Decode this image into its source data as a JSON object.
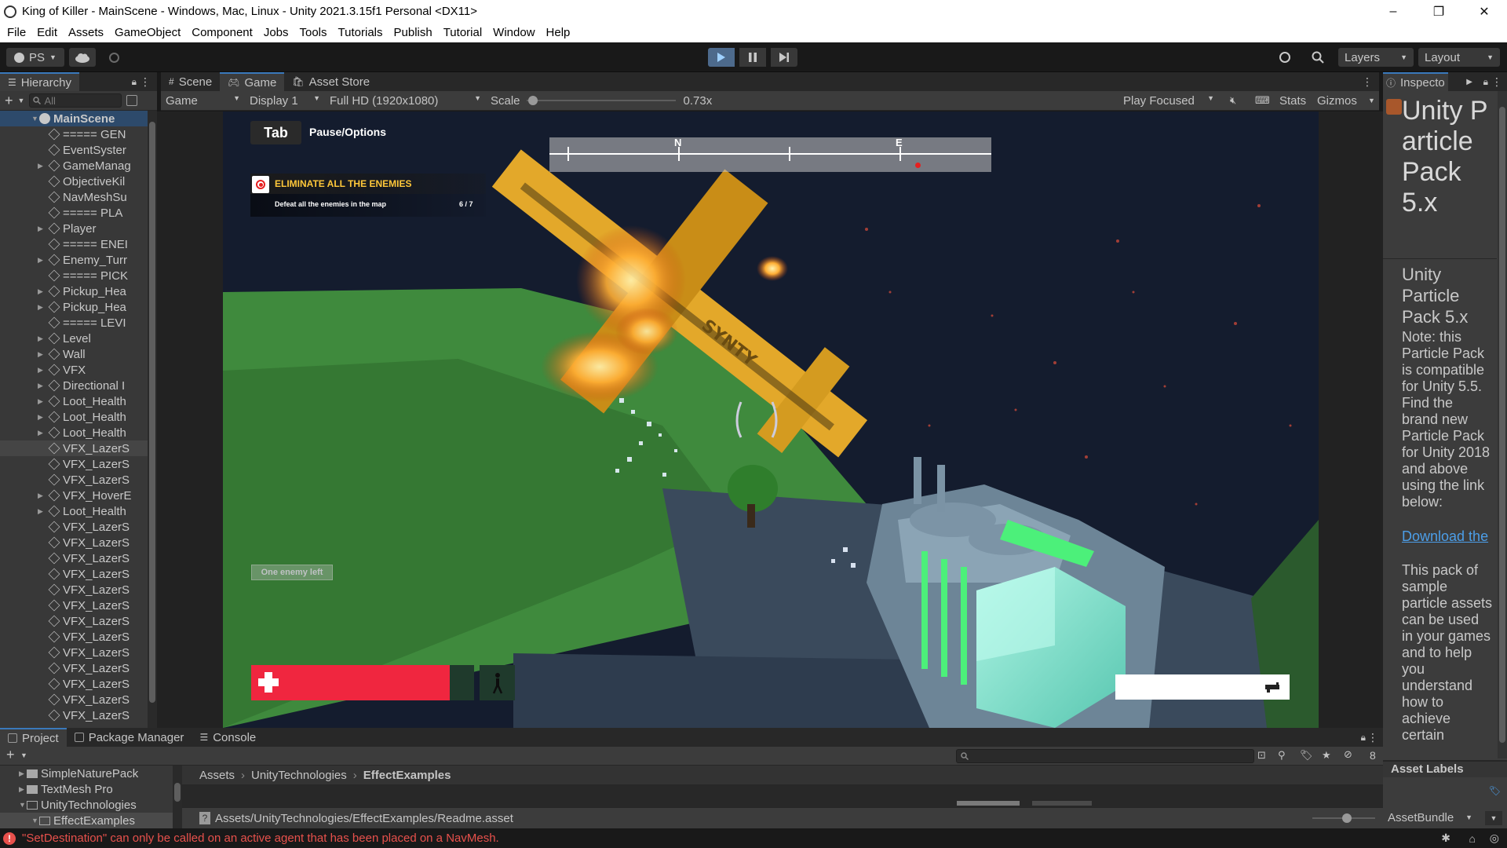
{
  "window": {
    "title": "King of Killer - MainScene - Windows, Mac, Linux - Unity 2021.3.15f1 Personal <DX11>",
    "controls": [
      "–",
      "❐",
      "✕"
    ]
  },
  "menu": [
    "File",
    "Edit",
    "Assets",
    "GameObject",
    "Component",
    "Jobs",
    "Tools",
    "Tutorials",
    "Publish",
    "Tutorial",
    "Window",
    "Help"
  ],
  "toolbar": {
    "account": "PS",
    "layers": "Layers",
    "layout": "Layout"
  },
  "hierarchy": {
    "tab": "Hierarchy",
    "search_placeholder": "All",
    "scene": "MainScene",
    "items": [
      {
        "label": "===== GEN",
        "expand": false
      },
      {
        "label": "EventSyster",
        "expand": false
      },
      {
        "label": "GameManag",
        "expand": true
      },
      {
        "label": "ObjectiveKil",
        "expand": false
      },
      {
        "label": "NavMeshSu",
        "expand": false
      },
      {
        "label": "===== PLA",
        "expand": false
      },
      {
        "label": "Player",
        "expand": true
      },
      {
        "label": "===== ENEI",
        "expand": false
      },
      {
        "label": "Enemy_Turr",
        "expand": true
      },
      {
        "label": "===== PICK",
        "expand": false
      },
      {
        "label": "Pickup_Hea",
        "expand": true
      },
      {
        "label": "Pickup_Hea",
        "expand": true
      },
      {
        "label": "===== LEVI",
        "expand": false
      },
      {
        "label": "Level",
        "expand": true
      },
      {
        "label": "Wall",
        "expand": true
      },
      {
        "label": "VFX",
        "expand": true
      },
      {
        "label": "Directional I",
        "expand": true
      },
      {
        "label": "Loot_Health",
        "expand": true
      },
      {
        "label": "Loot_Health",
        "expand": true
      },
      {
        "label": "Loot_Health",
        "expand": true
      },
      {
        "label": "VFX_LazerS",
        "expand": false
      },
      {
        "label": "VFX_LazerS",
        "expand": false
      },
      {
        "label": "VFX_LazerS",
        "expand": false
      },
      {
        "label": "VFX_HoverE",
        "expand": true
      },
      {
        "label": "Loot_Health",
        "expand": true
      },
      {
        "label": "VFX_LazerS",
        "expand": false
      },
      {
        "label": "VFX_LazerS",
        "expand": false
      },
      {
        "label": "VFX_LazerS",
        "expand": false
      },
      {
        "label": "VFX_LazerS",
        "expand": false
      },
      {
        "label": "VFX_LazerS",
        "expand": false
      },
      {
        "label": "VFX_LazerS",
        "expand": false
      },
      {
        "label": "VFX_LazerS",
        "expand": false
      },
      {
        "label": "VFX_LazerS",
        "expand": false
      },
      {
        "label": "VFX_LazerS",
        "expand": false
      },
      {
        "label": "VFX_LazerS",
        "expand": false
      },
      {
        "label": "VFX_LazerS",
        "expand": false
      },
      {
        "label": "VFX_LazerS",
        "expand": false
      },
      {
        "label": "VFX_LazerS",
        "expand": false
      }
    ]
  },
  "center_tabs": [
    "Scene",
    "Game",
    "Asset Store"
  ],
  "game_bar": {
    "mode": "Game",
    "display": "Display 1",
    "resolution": "Full HD (1920x1080)",
    "scale_label": "Scale",
    "scale_value": "0.73x",
    "play_focused": "Play Focused",
    "stats": "Stats",
    "gizmos": "Gizmos"
  },
  "hud": {
    "tab_key": "Tab",
    "pause_label": "Pause/Options",
    "compass_n": "N",
    "compass_e": "E",
    "objective_title": "ELIMINATE ALL THE ENEMIES",
    "objective_desc": "Defeat all the enemies in the map",
    "objective_count": "6 / 7",
    "notice": "One enemy left",
    "health_fraction": 0.89,
    "plane_text": "SYNTY"
  },
  "inspector": {
    "tab": "Inspecto",
    "title": "Unity Particle Pack 5.x",
    "subtitle": "Unity Particle Pack 5.x",
    "note": "Note: this Particle Pack is compatible for Unity 5.5. Find the brand new Particle Pack for Unity 2018 and above using the link below:",
    "link": "Download the",
    "body": "This pack of sample particle assets can be used in your games and to help you understand how to achieve certain",
    "asset_labels": "Asset Labels",
    "asset_bundle": "AssetBundle"
  },
  "bottom": {
    "tabs": [
      "Project",
      "Package Manager",
      "Console"
    ],
    "tree": [
      "SimpleNaturePack",
      "TextMesh Pro",
      "UnityTechnologies",
      "EffectExamples"
    ],
    "breadcrumb": [
      "Assets",
      "UnityTechnologies",
      "EffectExamples"
    ],
    "path": "Assets/UnityTechnologies/EffectExamples/Readme.asset",
    "hidden_count": "8"
  },
  "status": {
    "message": "\"SetDestination\" can only be called on an active agent that has been placed on a NavMesh."
  },
  "colors": {
    "accent": "#3a79bb",
    "error": "#e8514c",
    "health": "#f0263f",
    "objective": "#ffc83a",
    "link": "#4c9ee8"
  }
}
